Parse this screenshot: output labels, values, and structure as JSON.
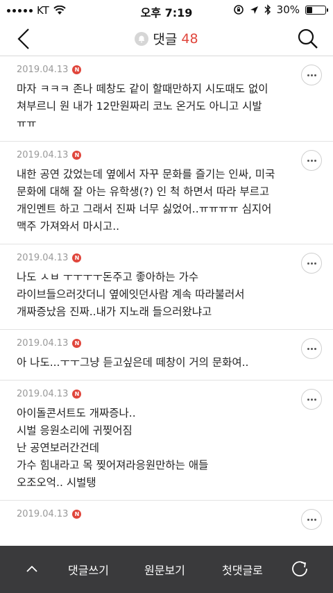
{
  "status_bar": {
    "carrier": "KT",
    "time": "오후 7:19",
    "battery": "30%",
    "battery_level": 0.3
  },
  "nav": {
    "title": "댓글",
    "count": "48"
  },
  "comments": [
    {
      "date": "2019.04.13",
      "badge": "N",
      "text": "마자 ㅋㅋㅋ 존나 떼창도 같이 할때만하지 시도때도 없이\n쳐부르니 원 내가 12만원짜리 코노 온거도 아니고 시발\nㅠㅠ"
    },
    {
      "date": "2019.04.13",
      "badge": "N",
      "text": "내한 공연 갔었는데 옆에서 자꾸 문화를 즐기는 인싸, 미국\n문화에 대해 잘 아는 유학생(?) 인 척 하면서 따라 부르고\n개인멘트 하고 그래서 진짜 너무 싫었어..ㅠㅠㅠㅠ 심지어\n맥주 가져와서 마시고.."
    },
    {
      "date": "2019.04.13",
      "badge": "N",
      "text": "나도 ㅅㅂ ㅜㅜㅜㅜ돈주고 좋아하는 가수\n라이브들으러갓더니 옆에잇던사람 계속 따라불러서\n개짜증났음 진짜..내가 지노래 들으러왔냐고"
    },
    {
      "date": "2019.04.13",
      "badge": "N",
      "text": "아 나도...ㅜㅜ그냥 듣고싶은데 떼창이 거의 문화여.."
    },
    {
      "date": "2019.04.13",
      "badge": "N",
      "text": "아이돌콘서트도 개짜증나..\n시벌 응원소리에 귀찢어짐\n난 공연보러간건데\n가수 힘내라고 목 찢어져라응원만하는 애들\n오조오억.. 시벌탱"
    },
    {
      "date": "2019.04.13",
      "badge": "N",
      "text": ""
    }
  ],
  "bottom_bar": {
    "write": "댓글쓰기",
    "original": "원문보기",
    "first": "첫댓글로"
  }
}
